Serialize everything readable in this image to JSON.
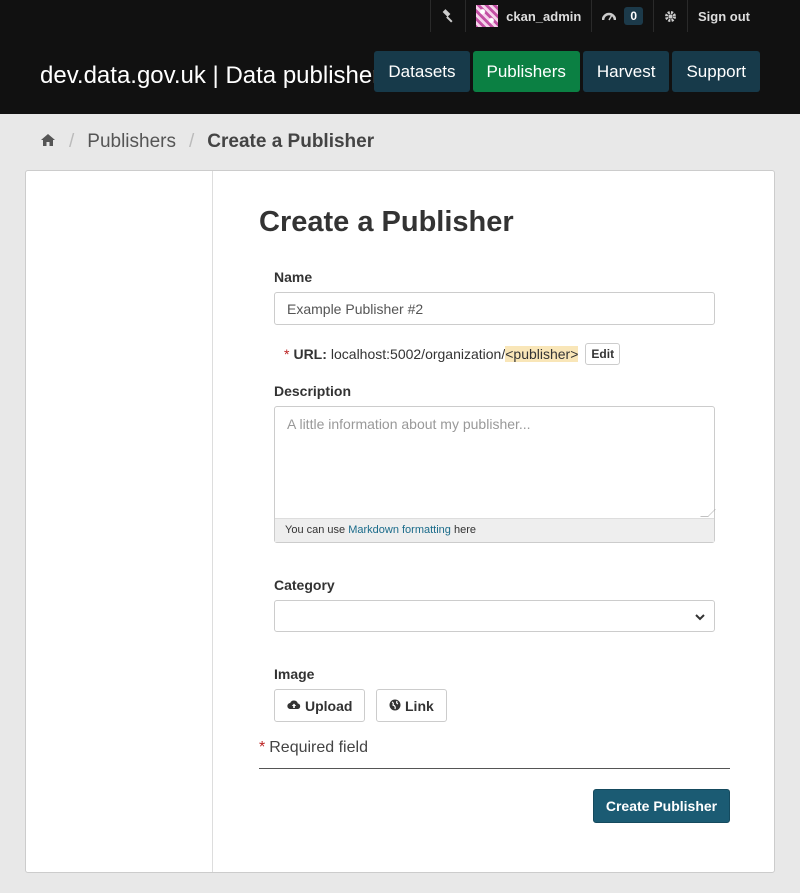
{
  "account": {
    "username": "ckan_admin",
    "dashboard_count": "0",
    "signout_label": "Sign out"
  },
  "header": {
    "site_title": "dev.data.gov.uk | Data publisher",
    "nav": [
      {
        "label": "Datasets",
        "active": false
      },
      {
        "label": "Publishers",
        "active": true
      },
      {
        "label": "Harvest",
        "active": false
      },
      {
        "label": "Support",
        "active": false
      }
    ]
  },
  "breadcrumb": {
    "items": [
      "Publishers",
      "Create a Publisher"
    ]
  },
  "form": {
    "heading": "Create a Publisher",
    "name_label": "Name",
    "name_value": "Example Publisher #2",
    "url_required_marker": "*",
    "url_label": "URL:",
    "url_prefix": "localhost:5002/organization/",
    "url_slug": "<publisher>",
    "url_edit_label": "Edit",
    "description_label": "Description",
    "description_placeholder": "A little information about my publisher...",
    "markdown_prefix": "You can use ",
    "markdown_link": "Markdown formatting",
    "markdown_suffix": " here",
    "category_label": "Category",
    "category_value": "",
    "image_label": "Image",
    "upload_label": "Upload",
    "link_label": "Link",
    "required_marker": "*",
    "required_note": "Required field",
    "submit_label": "Create Publisher"
  },
  "colors": {
    "topbar": "#111111",
    "nav": "#173a4a",
    "nav_active": "#0b8043",
    "submit": "#1b5b73",
    "required": "#bb2222"
  }
}
